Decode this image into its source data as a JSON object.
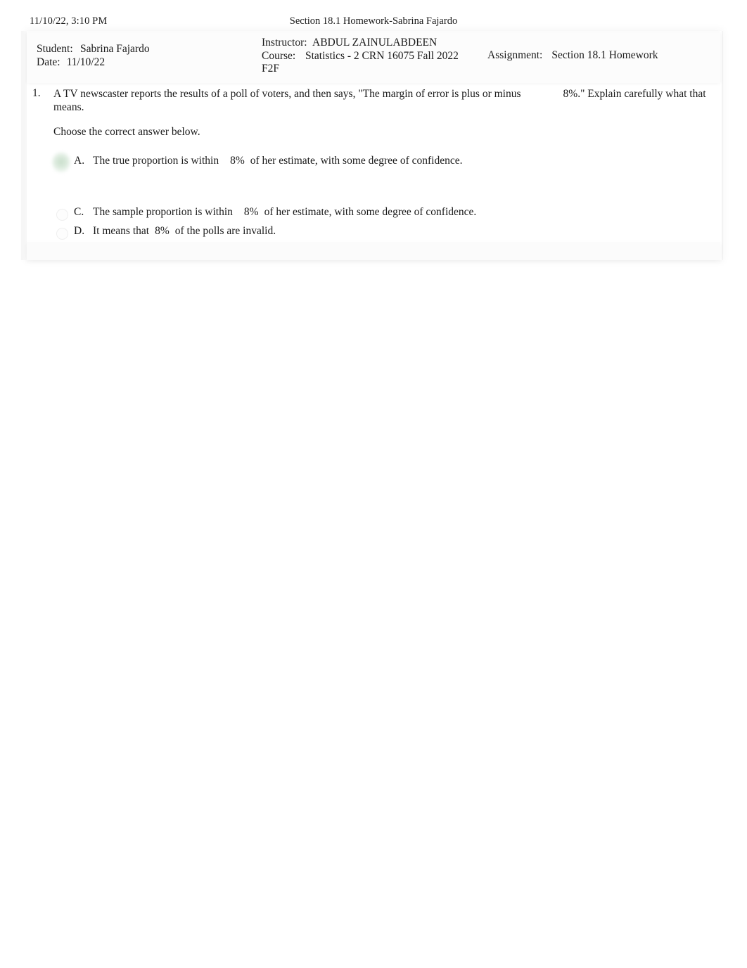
{
  "print_header": {
    "date_time": "11/10/22, 3:10 PM",
    "title": "Section 18.1 Homework-Sabrina Fajardo"
  },
  "info": {
    "student_label": "Student:",
    "student_value": "Sabrina Fajardo",
    "date_label": "Date:",
    "date_value": "11/10/22",
    "instructor_label": "Instructor:",
    "instructor_value": "ABDUL ZAINULABDEEN",
    "course_label": "Course:",
    "course_value": "Statistics - 2 CRN 16075 Fall 2022",
    "course_value_line2": "F2F",
    "assignment_label": "Assignment:",
    "assignment_value": "Section 18.1 Homework"
  },
  "question": {
    "number": "1.",
    "text_part1": "A TV newscaster reports the results of a poll of voters, and then says, \"The margin of error is plus or minus",
    "text_part2": "8%.\" Explain carefully what that means.",
    "prompt": "Choose the correct answer below."
  },
  "options": [
    {
      "letter": "A.",
      "text_part1": "The true proportion is within",
      "value": "8%",
      "text_part2": "of her estimate, with some degree of confidence.",
      "selected": true
    },
    {
      "letter": "C.",
      "text_part1": "The sample proportion is within",
      "value": "8%",
      "text_part2": "of her estimate, with some degree of confidence.",
      "selected": false
    },
    {
      "letter": "D.",
      "text_part1": "It means that",
      "value": "8%",
      "text_part2": "of the polls are invalid.",
      "selected": false
    }
  ],
  "colors": {
    "selection_highlight": "#dfe9e0",
    "page_background": "#ffffff",
    "text": "#1a1a1a"
  }
}
